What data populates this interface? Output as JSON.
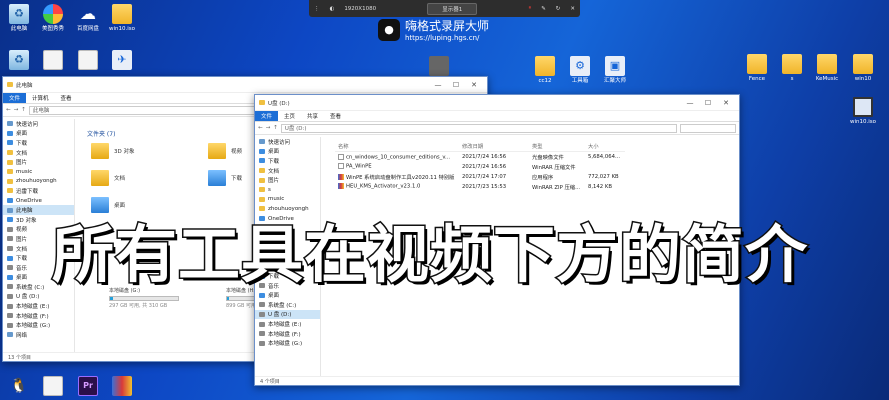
{
  "desktop_icons": [
    {
      "label": "此电脑",
      "icon": "recycle-bin-icon"
    },
    {
      "label": "美图秀秀",
      "icon": "color-wheel-icon"
    },
    {
      "label": "百度网盘",
      "icon": "cloud-icon"
    },
    {
      "label": "win10.iso",
      "icon": "folder-icon"
    },
    {
      "label": "",
      "icon": "recycle-bin-icon"
    },
    {
      "label": "",
      "icon": "document-icon"
    },
    {
      "label": "",
      "icon": "document-icon"
    },
    {
      "label": "",
      "icon": "app-icon"
    },
    {
      "label": "",
      "icon": "qq-icon"
    },
    {
      "label": "",
      "icon": "document-icon"
    },
    {
      "label": "Pr",
      "icon": "premiere-icon"
    },
    {
      "label": "",
      "icon": "winrar-icon"
    }
  ],
  "right_icons": [
    {
      "label": "",
      "icon": "printer-icon"
    },
    {
      "label": "cc12",
      "icon": "folder-icon"
    },
    {
      "label": "工具箱",
      "icon": "app-icon"
    },
    {
      "label": "汇聚大师",
      "icon": "app-icon"
    },
    {
      "label": "Fence",
      "icon": "folder-icon"
    },
    {
      "label": "s",
      "icon": "folder-icon"
    },
    {
      "label": "KeMusic",
      "icon": "folder-icon"
    },
    {
      "label": "win10",
      "icon": "folder-icon"
    },
    {
      "label": "win10.iso",
      "icon": "monitor-icon"
    }
  ],
  "recorder": {
    "resolution": "1920X1080",
    "monitor": "显示器1",
    "brand_title": "嗨格式录屏大师",
    "brand_url": "https://luping.hgs.cn/"
  },
  "win1": {
    "title": "此电脑",
    "tabs": [
      "文件",
      "计算机",
      "查看"
    ],
    "address": "此电脑",
    "nav": [
      {
        "label": "快速访问",
        "icon": "c"
      },
      {
        "label": "桌面",
        "icon": "b"
      },
      {
        "label": "下载",
        "icon": "b"
      },
      {
        "label": "文档",
        "icon": "y"
      },
      {
        "label": "图片",
        "icon": "y"
      },
      {
        "label": "music",
        "icon": "y"
      },
      {
        "label": "zhouhuoyongh",
        "icon": "y"
      },
      {
        "label": "迅雷下载",
        "icon": "y"
      },
      {
        "label": "OneDrive",
        "icon": "b"
      },
      {
        "label": "此电脑",
        "icon": "c",
        "selected": true
      },
      {
        "label": "3D 对象",
        "icon": "b"
      },
      {
        "label": "视频",
        "icon": "g"
      },
      {
        "label": "图片",
        "icon": "g"
      },
      {
        "label": "文档",
        "icon": "g"
      },
      {
        "label": "下载",
        "icon": "b"
      },
      {
        "label": "音乐",
        "icon": "g"
      },
      {
        "label": "桌面",
        "icon": "b"
      },
      {
        "label": "系统盘 (C:)",
        "icon": "g"
      },
      {
        "label": "U 盘 (D:)",
        "icon": "g"
      },
      {
        "label": "本地磁盘 (E:)",
        "icon": "g"
      },
      {
        "label": "本地磁盘 (F:)",
        "icon": "g"
      },
      {
        "label": "本地磁盘 (G:)",
        "icon": "g"
      },
      {
        "label": "网络",
        "icon": "c"
      }
    ],
    "section": "文件夹 (7)",
    "folders": [
      {
        "label": "3D 对象",
        "icon": "y"
      },
      {
        "label": "视频",
        "icon": "y"
      },
      {
        "label": "文档",
        "icon": "y"
      },
      {
        "label": "下载",
        "icon": "dl"
      },
      {
        "label": "桌面",
        "icon": "bl"
      }
    ],
    "drives": [
      {
        "label": "本地磁盘 (G:)",
        "free": "297 GB 可用, 共 310 GB",
        "used": 0.05
      },
      {
        "label": "本地磁盘 (H:)",
        "free": "899 GB 可用, 共 931 GB",
        "used": 0.03
      }
    ],
    "status": "13 个项目"
  },
  "win2": {
    "title": "U盘 (D:)",
    "tabs": [
      "文件",
      "主页",
      "共享",
      "查看"
    ],
    "address": "U盘 (D:)",
    "columns": [
      "名称",
      "修改日期",
      "类型",
      "大小"
    ],
    "files": [
      {
        "name": "cn_windows_10_consumer_editions_v...",
        "date": "2021/7/24 16:56",
        "type": "光盘映像文件",
        "size": "5,684,064...",
        "icon": "w"
      },
      {
        "name": "PA_WinPE",
        "date": "2021/7/24 16:56",
        "type": "WinRAR 压缩文件",
        "size": "",
        "icon": "w"
      },
      {
        "name": "WinPE 系统启动盘制作工具v2020.11 特别版",
        "date": "2021/7/24 17:07",
        "type": "应用程序",
        "size": "772,027 KB",
        "icon": "r"
      },
      {
        "name": "HEU_KMS_Activator_v23.1.0",
        "date": "2021/7/23 15:53",
        "type": "WinRAR ZIP 压缩...",
        "size": "8,142 KB",
        "icon": "r"
      }
    ],
    "nav": [
      {
        "label": "快速访问",
        "icon": "c"
      },
      {
        "label": "桌面",
        "icon": "b"
      },
      {
        "label": "下载",
        "icon": "b"
      },
      {
        "label": "文档",
        "icon": "y"
      },
      {
        "label": "图片",
        "icon": "y"
      },
      {
        "label": "s",
        "icon": "y"
      },
      {
        "label": "music",
        "icon": "y"
      },
      {
        "label": "zhouhuoyongh",
        "icon": "y"
      },
      {
        "label": "OneDrive",
        "icon": "b"
      },
      {
        "label": "此电脑",
        "icon": "c"
      },
      {
        "label": "3D 对象",
        "icon": "b"
      },
      {
        "label": "视频",
        "icon": "g"
      },
      {
        "label": "图片",
        "icon": "g"
      },
      {
        "label": "文档",
        "icon": "g"
      },
      {
        "label": "下载",
        "icon": "b"
      },
      {
        "label": "音乐",
        "icon": "g"
      },
      {
        "label": "桌面",
        "icon": "b"
      },
      {
        "label": "系统盘 (C:)",
        "icon": "g"
      },
      {
        "label": "U 盘 (D:)",
        "icon": "g",
        "selected": true
      },
      {
        "label": "本地磁盘 (E:)",
        "icon": "g"
      },
      {
        "label": "本地磁盘 (F:)",
        "icon": "g"
      },
      {
        "label": "本地磁盘 (G:)",
        "icon": "g"
      }
    ],
    "status": "4 个项目"
  },
  "caption": "所有工具在视频下方的简介"
}
